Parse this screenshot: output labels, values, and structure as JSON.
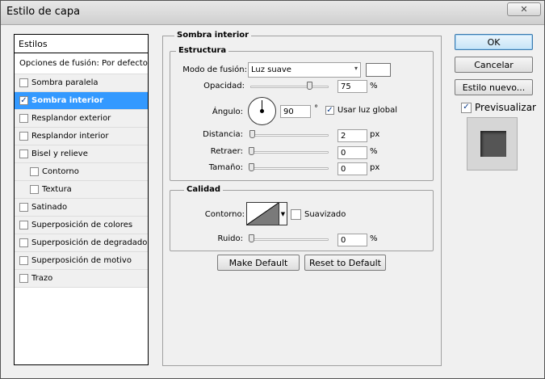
{
  "window": {
    "title": "Estilo de capa",
    "close_glyph": "✕"
  },
  "styles_panel": {
    "header": "Estilos",
    "items": [
      {
        "label": "Opciones de fusión: Por defecto",
        "checkbox": false,
        "checked": false,
        "selected": false
      },
      {
        "label": "Sombra paralela",
        "checkbox": true,
        "checked": false,
        "selected": false
      },
      {
        "label": "Sombra interior",
        "checkbox": true,
        "checked": true,
        "selected": true
      },
      {
        "label": "Resplandor exterior",
        "checkbox": true,
        "checked": false,
        "selected": false
      },
      {
        "label": "Resplandor interior",
        "checkbox": true,
        "checked": false,
        "selected": false
      },
      {
        "label": "Bisel y relieve",
        "checkbox": true,
        "checked": false,
        "selected": false
      },
      {
        "label": "Contorno",
        "checkbox": true,
        "checked": false,
        "selected": false,
        "indent": true
      },
      {
        "label": "Textura",
        "checkbox": true,
        "checked": false,
        "selected": false,
        "indent": true
      },
      {
        "label": "Satinado",
        "checkbox": true,
        "checked": false,
        "selected": false
      },
      {
        "label": "Superposición de colores",
        "checkbox": true,
        "checked": false,
        "selected": false
      },
      {
        "label": "Superposición de degradado",
        "checkbox": true,
        "checked": false,
        "selected": false
      },
      {
        "label": "Superposición de motivo",
        "checkbox": true,
        "checked": false,
        "selected": false
      },
      {
        "label": "Trazo",
        "checkbox": true,
        "checked": false,
        "selected": false
      }
    ]
  },
  "inner_shadow": {
    "group_title": "Sombra interior",
    "structure": {
      "title": "Estructura",
      "blend_mode_label": "Modo de fusión:",
      "blend_mode_value": "Luz suave",
      "opacity_label": "Opacidad:",
      "opacity_value": "75",
      "opacity_unit": "%",
      "opacity_fraction": 0.75,
      "angle_label": "Ángulo:",
      "angle_value": "90",
      "angle_unit": "°",
      "global_light_label": "Usar luz global",
      "global_light_checked": true,
      "distance_label": "Distancia:",
      "distance_value": "2",
      "distance_unit": "px",
      "choke_label": "Retraer:",
      "choke_value": "0",
      "choke_unit": "%",
      "size_label": "Tamaño:",
      "size_value": "0",
      "size_unit": "px"
    },
    "quality": {
      "title": "Calidad",
      "contour_label": "Contorno:",
      "antialias_label": "Suavizado",
      "antialias_checked": false,
      "noise_label": "Ruido:",
      "noise_value": "0",
      "noise_unit": "%"
    },
    "make_default_label": "Make Default",
    "reset_default_label": "Reset to Default"
  },
  "buttons": {
    "ok": "OK",
    "cancel": "Cancelar",
    "new_style": "Estilo nuevo...",
    "preview_label": "Previsualizar",
    "preview_checked": true
  },
  "colors": {
    "selection": "#3399ff",
    "shadow_color": "#ffffff",
    "preview_bg": "#d6d6d6",
    "preview_square": "#555555"
  }
}
